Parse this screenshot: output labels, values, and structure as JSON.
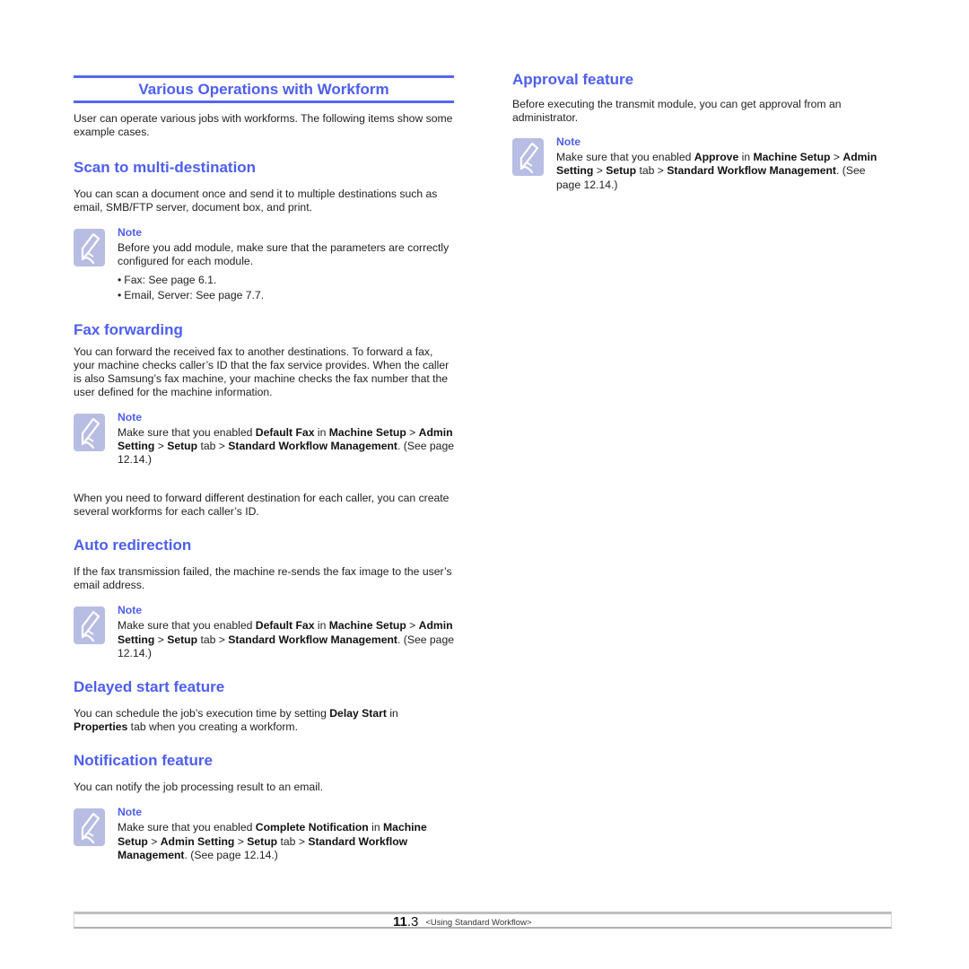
{
  "page": {
    "chapter_title": "Various Operations with Workform",
    "intro": "User can operate various jobs with workforms. The following items show some example cases.",
    "accent_color": "#4d5ef0"
  },
  "sections": {
    "scan": {
      "heading": "Scan to multi-destination",
      "body": "You can scan a document once and send it to multiple destinations such as email, SMB/FTP server, document box, and print.",
      "note": {
        "title": "Note",
        "text": "Before you add module, make sure that the parameters are correctly configured for each module.",
        "bullets": [
          "Fax: See  page 6.1.",
          "Email, Server: See  page 7.7."
        ]
      }
    },
    "fax_forwarding": {
      "heading": "Fax forwarding",
      "body": "You can forward the received fax to another destinations. To forward a fax, your machine checks caller’s ID that the fax service provides. When the caller is also Samsung’s fax machine, your machine checks the fax number that the user defined for the machine information.",
      "note": {
        "title": "Note",
        "parts": [
          "Make sure that you enabled ",
          "Default Fax",
          " in ",
          "Machine Setup",
          " > ",
          "Admin Setting",
          " > ",
          "Setup",
          " tab > ",
          "Standard Workflow Management",
          ". (See  page 12.14.)"
        ]
      },
      "after": "When you need to forward different destination for each caller, you can create several workforms for each caller’s ID."
    },
    "auto_redirection": {
      "heading": "Auto redirection",
      "body": "If the fax transmission failed, the machine re-sends the fax image to the user’s email address.",
      "note": {
        "title": "Note",
        "parts": [
          "Make sure that you enabled ",
          "Default Fax",
          " in ",
          "Machine Setup",
          " > ",
          "Admin Setting",
          " > ",
          "Setup",
          " tab > ",
          "Standard Workflow Management",
          ". (See  page 12.14.)"
        ]
      }
    },
    "delayed_start": {
      "heading": "Delayed start feature",
      "parts": [
        "You can schedule the job’s execution time by setting ",
        "Delay Start",
        " in ",
        "Properties",
        " tab when you creating a workform."
      ]
    },
    "notification": {
      "heading": "Notification feature",
      "body": "You can notify the job processing result to an email.",
      "note": {
        "title": "Note",
        "parts": [
          "Make sure that you enabled ",
          "Complete Notification",
          " in ",
          "Machine Setup",
          " > ",
          "Admin Setting",
          " > ",
          "Setup",
          " tab > ",
          "Standard Workflow Management",
          ". (See  page 12.14.)"
        ]
      }
    },
    "approval": {
      "heading": "Approval feature",
      "body": "Before executing the transmit module, you can get approval from an administrator.",
      "note": {
        "title": "Note",
        "parts": [
          "Make sure that you enabled ",
          "Approve",
          " in ",
          "Machine Setup",
          " > ",
          "Admin Setting",
          " > ",
          "Setup",
          " tab > ",
          "Standard Workflow Management",
          ". (See  page 12.14.)"
        ]
      }
    }
  },
  "footer": {
    "chapter": "11",
    "page": ".3",
    "label": "<Using Standard Workflow>"
  }
}
